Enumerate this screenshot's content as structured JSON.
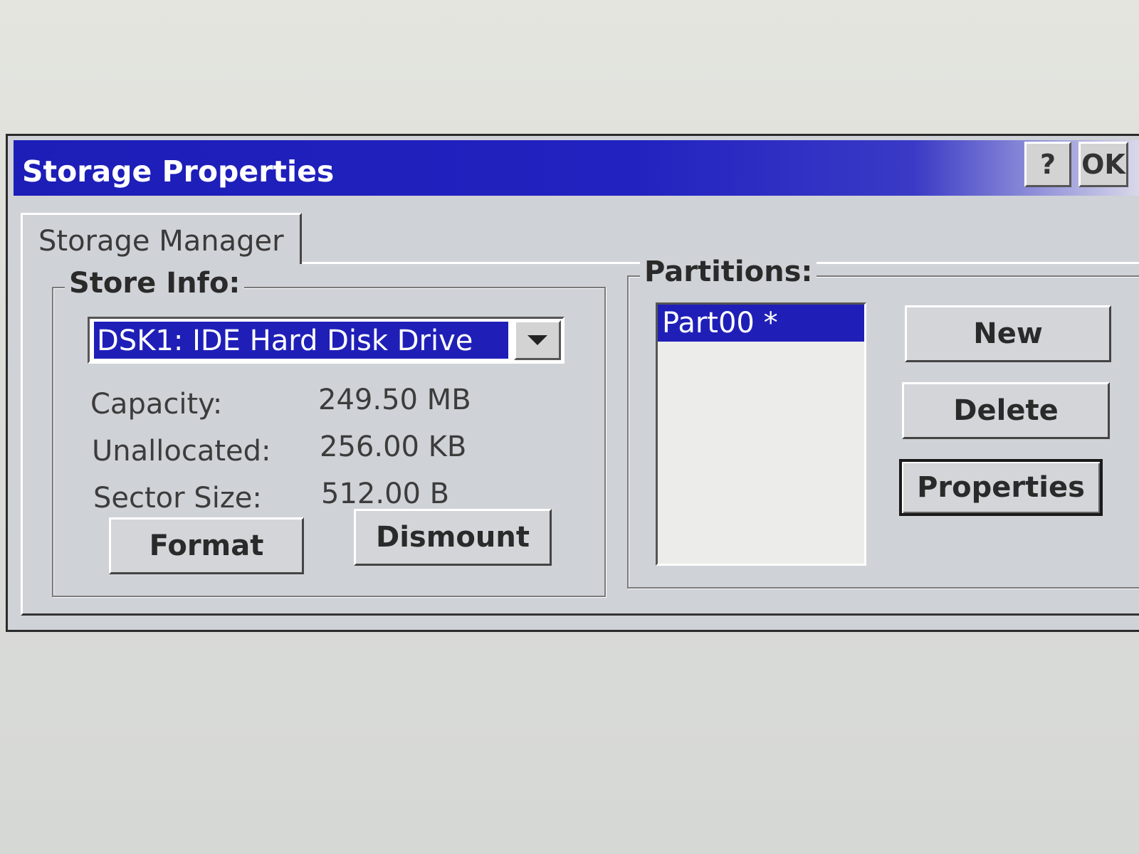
{
  "window": {
    "title": "Storage Properties",
    "help_label": "?",
    "ok_label": "OK"
  },
  "tabs": [
    {
      "label": "Storage Manager"
    }
  ],
  "store_info": {
    "legend": "Store Info:",
    "selected_store": "DSK1: IDE Hard Disk Drive",
    "fields": [
      {
        "label": "Capacity:",
        "value": "249.50 MB"
      },
      {
        "label": "Unallocated:",
        "value": "256.00 KB"
      },
      {
        "label": "Sector Size:",
        "value": "512.00 B"
      }
    ],
    "format_label": "Format",
    "dismount_label": "Dismount"
  },
  "partitions": {
    "legend": "Partitions:",
    "items": [
      {
        "label": "Part00 *"
      }
    ],
    "new_label": "New",
    "delete_label": "Delete",
    "properties_label": "Properties"
  },
  "colors": {
    "titlebar": "#1f1fb8",
    "selection": "#1f1fb8",
    "dialog_face": "#cfd2d6"
  }
}
